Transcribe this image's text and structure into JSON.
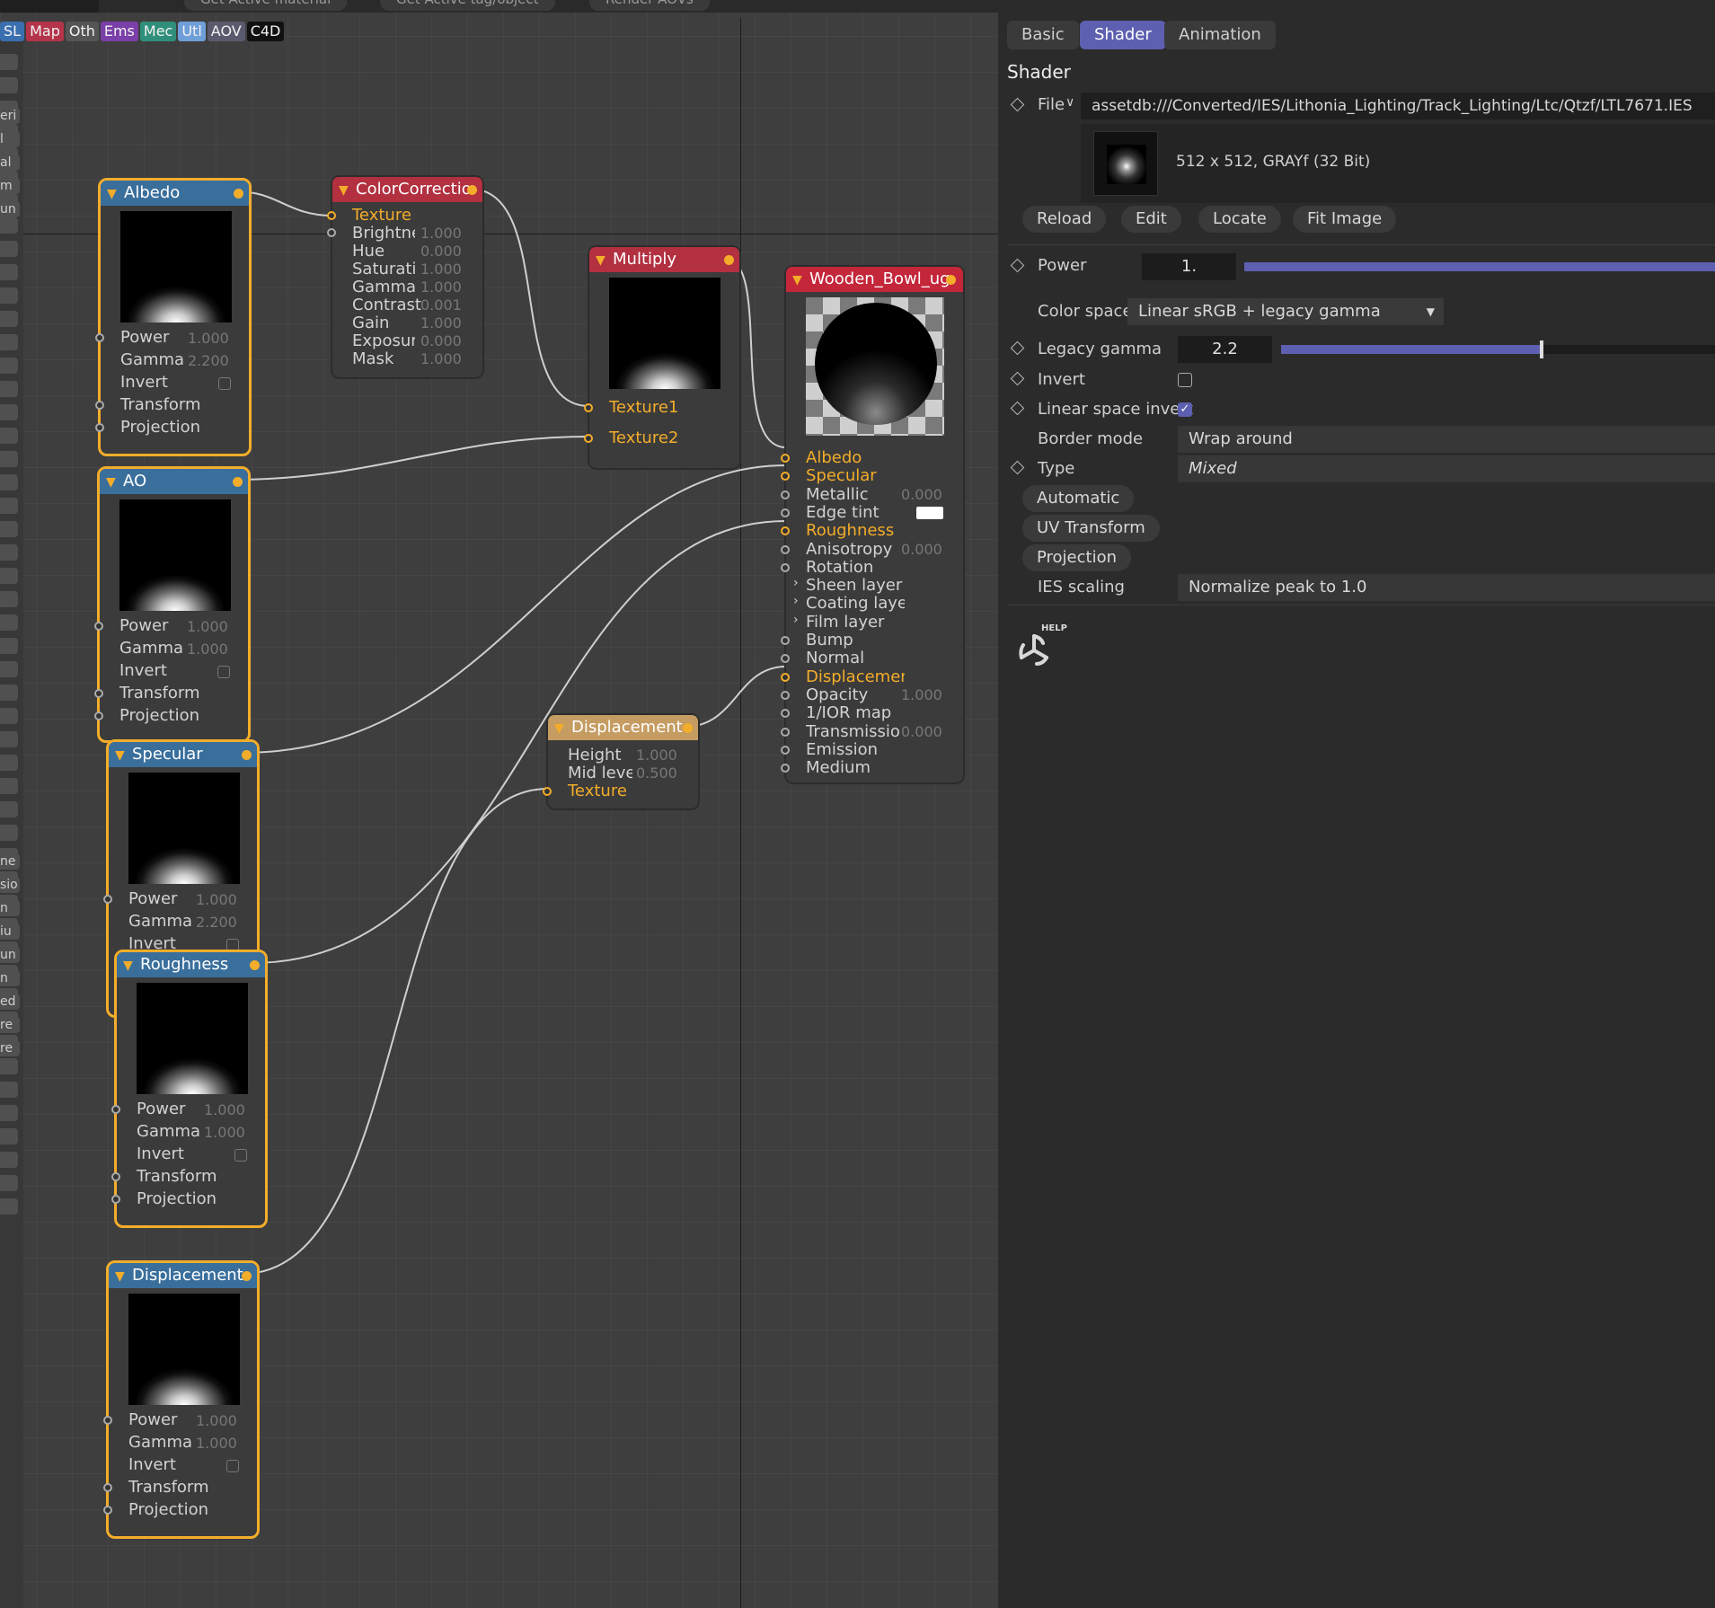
{
  "toolbar": {
    "buttons": [
      "Get Active material",
      "Get Active tag/object",
      "Render AOVs"
    ]
  },
  "categories": [
    {
      "label": "SL",
      "color": "#3a6fb0"
    },
    {
      "label": "Map",
      "color": "#b4344a"
    },
    {
      "label": "Oth",
      "color": "#555555"
    },
    {
      "label": "Ems",
      "color": "#7a3fa8"
    },
    {
      "label": "Mec",
      "color": "#2f8f7a"
    },
    {
      "label": "Utl",
      "color": "#6f9fd8"
    },
    {
      "label": "AOV",
      "color": "#5a5a6e"
    },
    {
      "label": "C4D",
      "color": "#111111"
    }
  ],
  "left_strip": [
    "eri",
    "l",
    "al",
    "m",
    "un",
    "ne",
    "sio",
    "n",
    "iu",
    "un",
    "n",
    "ed",
    "re",
    "re"
  ],
  "nodes": {
    "albedo": {
      "title": "Albedo",
      "params": [
        {
          "label": "Power",
          "value": "1.000"
        },
        {
          "label": "Gamma",
          "value": "2.200"
        },
        {
          "label": "Invert",
          "value": ""
        },
        {
          "label": "Transform",
          "value": ""
        },
        {
          "label": "Projection",
          "value": ""
        }
      ]
    },
    "ao": {
      "title": "AO",
      "params": [
        {
          "label": "Power",
          "value": "1.000"
        },
        {
          "label": "Gamma",
          "value": "1.000"
        },
        {
          "label": "Invert",
          "value": ""
        },
        {
          "label": "Transform",
          "value": ""
        },
        {
          "label": "Projection",
          "value": ""
        }
      ]
    },
    "specular": {
      "title": "Specular",
      "params": [
        {
          "label": "Power",
          "value": "1.000"
        },
        {
          "label": "Gamma",
          "value": "2.200"
        },
        {
          "label": "Invert",
          "value": ""
        }
      ]
    },
    "roughness": {
      "title": "Roughness",
      "params": [
        {
          "label": "Power",
          "value": "1.000"
        },
        {
          "label": "Gamma",
          "value": "1.000"
        },
        {
          "label": "Invert",
          "value": ""
        },
        {
          "label": "Transform",
          "value": ""
        },
        {
          "label": "Projection",
          "value": ""
        }
      ]
    },
    "displacement_tex": {
      "title": "Displacement",
      "params": [
        {
          "label": "Power",
          "value": "1.000"
        },
        {
          "label": "Gamma",
          "value": "1.000"
        },
        {
          "label": "Invert",
          "value": ""
        },
        {
          "label": "Transform",
          "value": ""
        },
        {
          "label": "Projection",
          "value": ""
        }
      ]
    },
    "colorcorrection": {
      "title": "ColorCorrectio",
      "params": [
        {
          "label": "Texture",
          "value": ""
        },
        {
          "label": "Brightne",
          "value": "1.000"
        },
        {
          "label": "Hue",
          "value": "0.000"
        },
        {
          "label": "Saturatio",
          "value": "1.000"
        },
        {
          "label": "Gamma",
          "value": "1.000"
        },
        {
          "label": "Contrast",
          "value": "0.001"
        },
        {
          "label": "Gain",
          "value": "1.000"
        },
        {
          "label": "Exposur",
          "value": "0.000"
        },
        {
          "label": "Mask",
          "value": "1.000"
        }
      ]
    },
    "multiply": {
      "title": "Multiply",
      "params": [
        {
          "label": "Texture1",
          "value": ""
        },
        {
          "label": "Texture2",
          "value": ""
        }
      ]
    },
    "displacement": {
      "title": "Displacement",
      "params": [
        {
          "label": "Height",
          "value": "1.000"
        },
        {
          "label": "Mid leve",
          "value": "0.500"
        },
        {
          "label": "Texture",
          "value": ""
        }
      ]
    },
    "material": {
      "title": "Wooden_Bowl_ug",
      "params": [
        {
          "label": "Albedo",
          "value": ""
        },
        {
          "label": "Specular",
          "value": ""
        },
        {
          "label": "Metallic",
          "value": "0.000"
        },
        {
          "label": "Edge tint",
          "value": ""
        },
        {
          "label": "Roughness",
          "value": ""
        },
        {
          "label": "Anisotropy",
          "value": "0.000"
        },
        {
          "label": "Rotation",
          "value": ""
        },
        {
          "label": "Sheen layer",
          "value": ""
        },
        {
          "label": "Coating layer",
          "value": ""
        },
        {
          "label": "Film layer",
          "value": ""
        },
        {
          "label": "Bump",
          "value": ""
        },
        {
          "label": "Normal",
          "value": ""
        },
        {
          "label": "Displacement",
          "value": ""
        },
        {
          "label": "Opacity",
          "value": "1.000"
        },
        {
          "label": "1/IOR map",
          "value": ""
        },
        {
          "label": "Transmissio",
          "value": "0.000"
        },
        {
          "label": "Emission",
          "value": ""
        },
        {
          "label": "Medium",
          "value": ""
        }
      ]
    }
  },
  "panel": {
    "tabs": [
      "Basic",
      "Shader",
      "Animation"
    ],
    "active_tab": "Shader",
    "section_title": "Shader",
    "file_label": "File",
    "file_path": "assetdb:///Converted/IES/Lithonia_Lighting/Track_Lighting/Ltc/Qtzf/LTL7671.IES",
    "image_info": "512 x 512, GRAYf (32 Bit)",
    "file_buttons": [
      "Reload",
      "Edit",
      "Locate",
      "Fit Image"
    ],
    "power_label": "Power",
    "power_value": "1.",
    "power_fraction": 1.0,
    "color_space_label": "Color space",
    "color_space_value": "Linear sRGB + legacy gamma",
    "legacy_gamma_label": "Legacy gamma",
    "legacy_gamma_value": "2.2",
    "invert_label": "Invert",
    "invert_checked": false,
    "linear_space_invert_label": "Linear space invert",
    "linear_space_invert_checked": true,
    "border_mode_label": "Border mode",
    "border_mode_value": "Wrap around",
    "type_label": "Type",
    "type_value": "Mixed",
    "group_buttons": [
      "Automatic",
      "UV Transform",
      "Projection"
    ],
    "ies_scaling_label": "IES scaling",
    "ies_scaling_value": "Normalize peak to 1.0",
    "help_label": "HELP"
  },
  "colors": {
    "accent": "#5d5fb0",
    "selected_outline": "#f3ad2a",
    "texture_header": "#3a6f9c",
    "material_header": "#c4263a"
  }
}
